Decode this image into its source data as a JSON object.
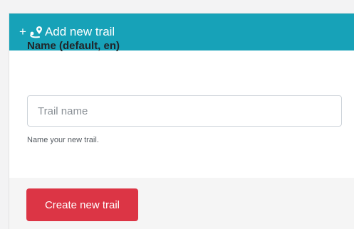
{
  "header": {
    "plus": "+",
    "title": "Add new trail",
    "icon": "route-icon",
    "color": "#17a2b8"
  },
  "form": {
    "name_label": "Name (default, en)",
    "name_placeholder": "Trail name",
    "name_value": "",
    "help": "Name your new trail."
  },
  "footer": {
    "submit_label": "Create new trail",
    "submit_color": "#dc3545"
  }
}
